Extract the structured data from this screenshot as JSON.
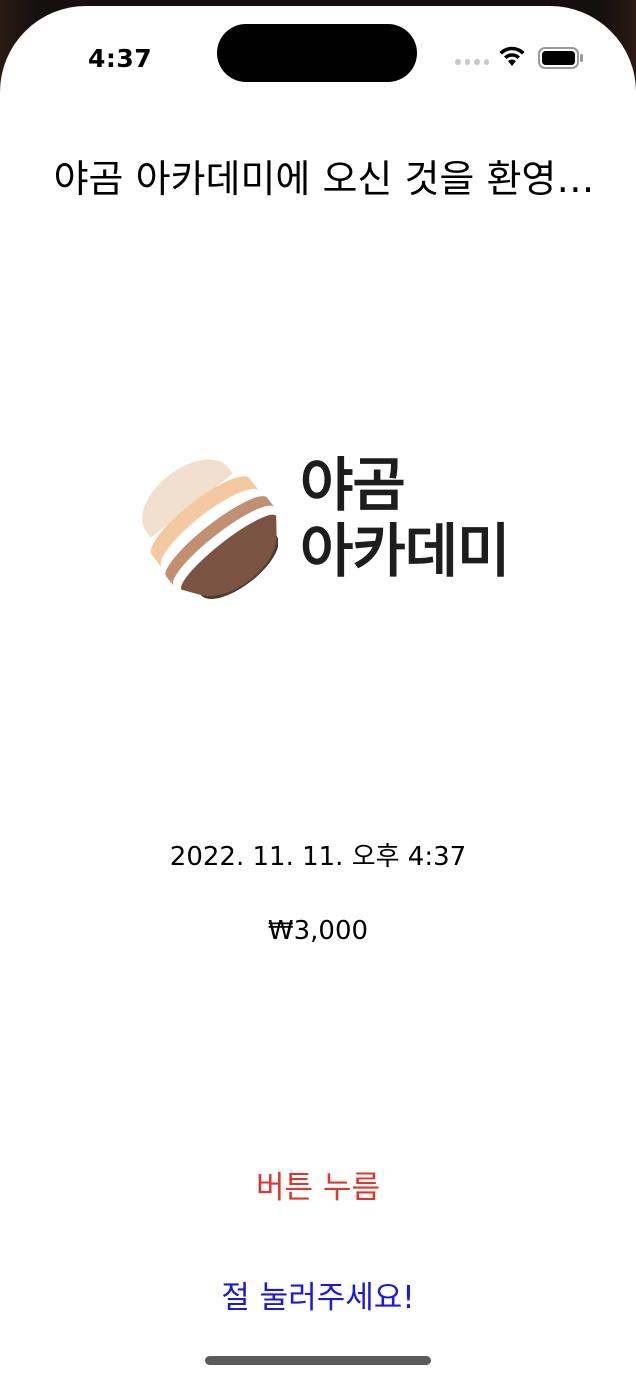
{
  "status_bar": {
    "time": "4:37"
  },
  "main": {
    "title": "야곰 아카데미에 오신 것을 환영…",
    "logo": {
      "line1": "야곰",
      "line2": "아카데미",
      "colors": [
        "#f1e0cd",
        "#f3c9a2",
        "#c19073",
        "#7a5343",
        "#4a3a33"
      ]
    },
    "date": "2022. 11. 11. 오후 4:37",
    "price": "₩3,000",
    "press_button_label": "버튼 누름",
    "please_button_label": "절 눌러주세요!"
  },
  "colors": {
    "press_button": "#e0352b",
    "please_button": "#1a1adf"
  }
}
